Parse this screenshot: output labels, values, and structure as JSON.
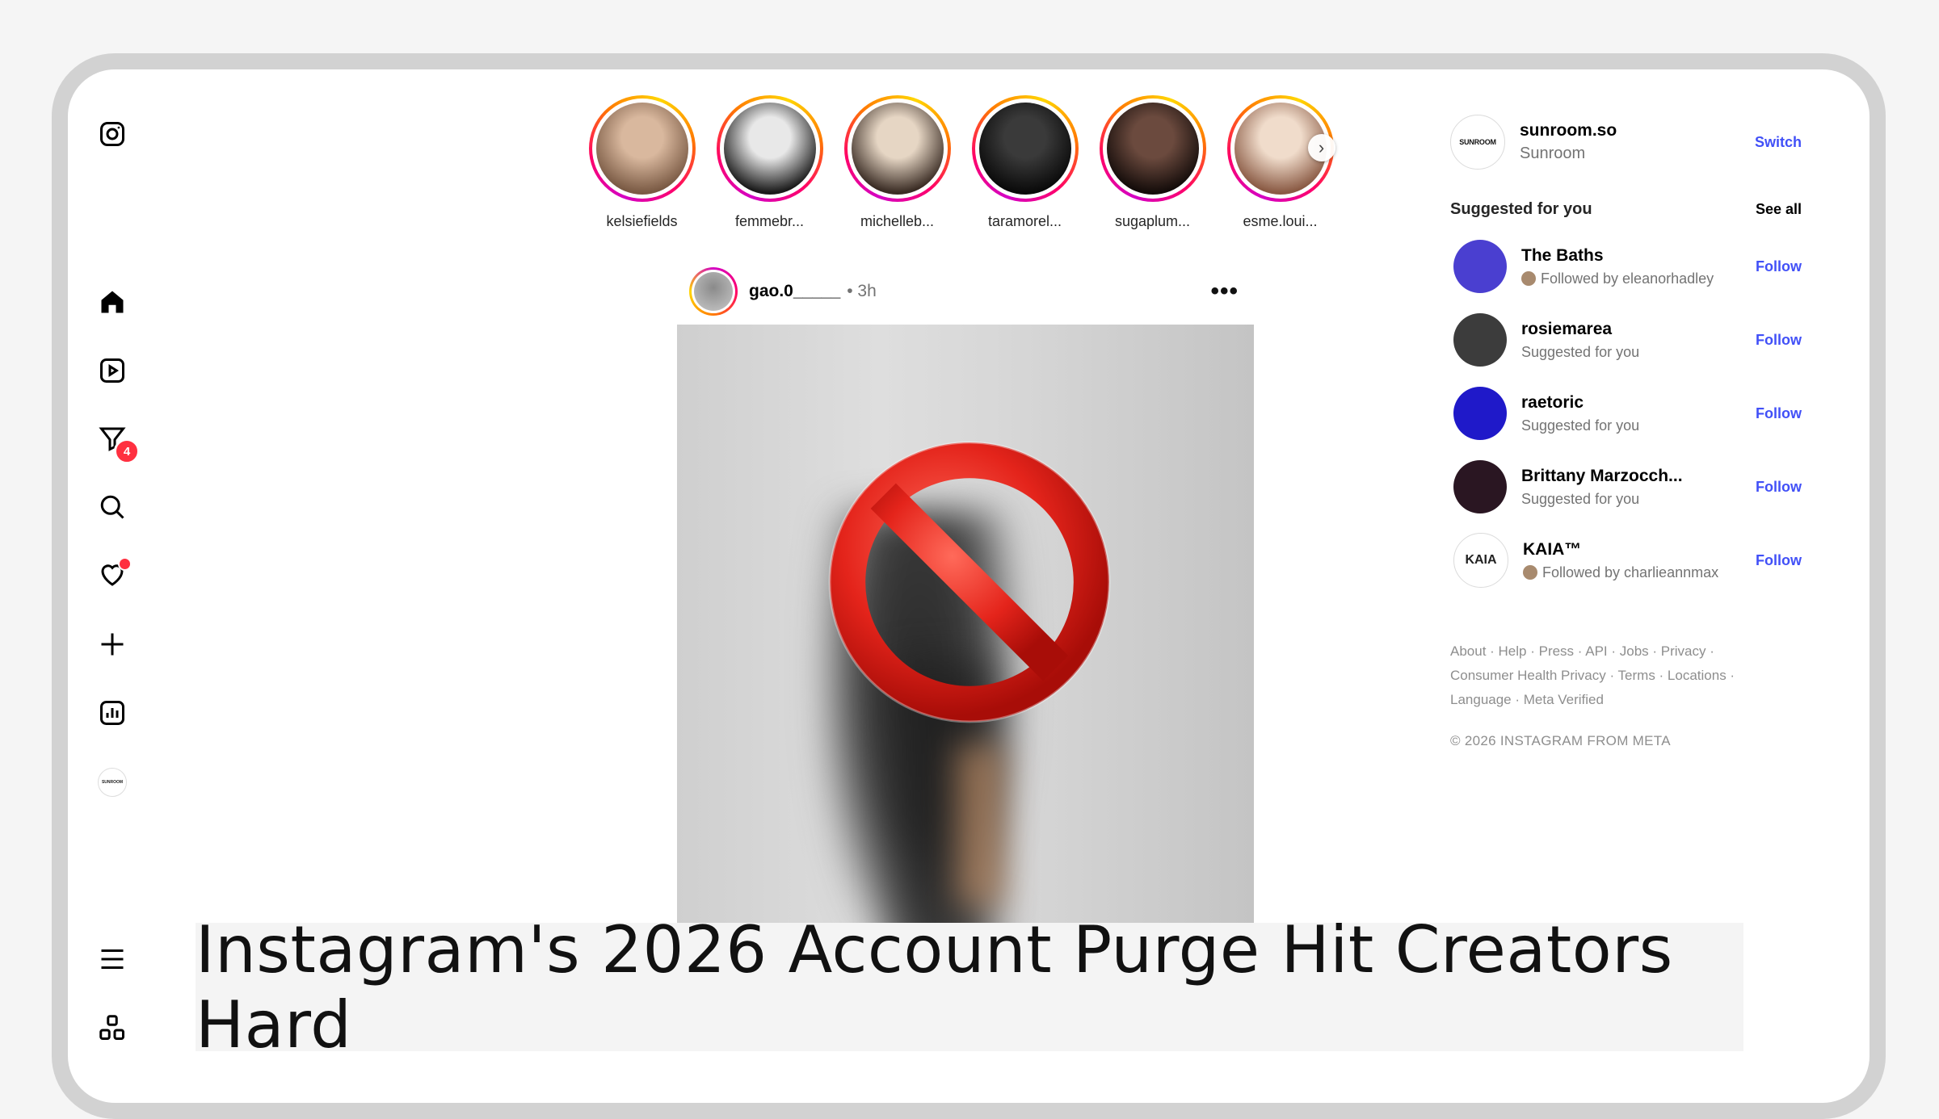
{
  "stories": [
    {
      "name": "kelsiefields",
      "grad": [
        "#d9b89e",
        "#7a5a44"
      ]
    },
    {
      "name": "femmebr...",
      "grad": [
        "#e8e8e8",
        "#1a1a1a"
      ]
    },
    {
      "name": "michelleb...",
      "grad": [
        "#e6d6c4",
        "#3a2c24"
      ]
    },
    {
      "name": "taramorel...",
      "grad": [
        "#3a3a3a",
        "#0a0a0a"
      ]
    },
    {
      "name": "sugaplum...",
      "grad": [
        "#6b4a3e",
        "#140c0a"
      ]
    },
    {
      "name": "esme.loui...",
      "grad": [
        "#f0dccb",
        "#8a5a44"
      ]
    }
  ],
  "story_next": "›",
  "post": {
    "username": "gao.0_____",
    "time": "• 3h",
    "more": "•••"
  },
  "account": {
    "avatar_text": "SUNROOM",
    "username": "sunroom.so",
    "name": "Sunroom",
    "switch_label": "Switch"
  },
  "suggestions": {
    "title": "Suggested for you",
    "see_all": "See all",
    "follow_label": "Follow",
    "items": [
      {
        "name": "The Baths",
        "sub": "Followed by eleanorhadley",
        "bg": "#4a3fd0",
        "has_mini": true,
        "avatar_text": ""
      },
      {
        "name": "rosiemarea",
        "sub": "Suggested for you",
        "bg": "#3c3c3c",
        "has_mini": false,
        "avatar_text": ""
      },
      {
        "name": "raetoric",
        "sub": "Suggested for you",
        "bg": "#1f19c9",
        "has_mini": false,
        "avatar_text": ""
      },
      {
        "name": "Brittany Marzocch...",
        "sub": "Suggested for you",
        "bg": "#2a1622",
        "has_mini": false,
        "avatar_text": ""
      },
      {
        "name": "KAIA™",
        "sub": "Followed by charlieannmax",
        "bg": "#ffffff",
        "has_mini": true,
        "avatar_text": "KAIA"
      }
    ]
  },
  "footer": {
    "line1": "About · Help · Press · API · Jobs · Privacy ·",
    "line2": "Consumer Health Privacy · Terms · Locations ·",
    "line3": "Language · Meta Verified",
    "copyright": "© 2026 INSTAGRAM FROM META"
  },
  "sidebar": {
    "notifications_badge": "4",
    "profile_avatar_text": "SUNROOM"
  },
  "caption": "Instagram's 2026 Account Purge Hit Creators Hard",
  "colors": {
    "link": "#4150f7",
    "badge": "#ff3040"
  }
}
